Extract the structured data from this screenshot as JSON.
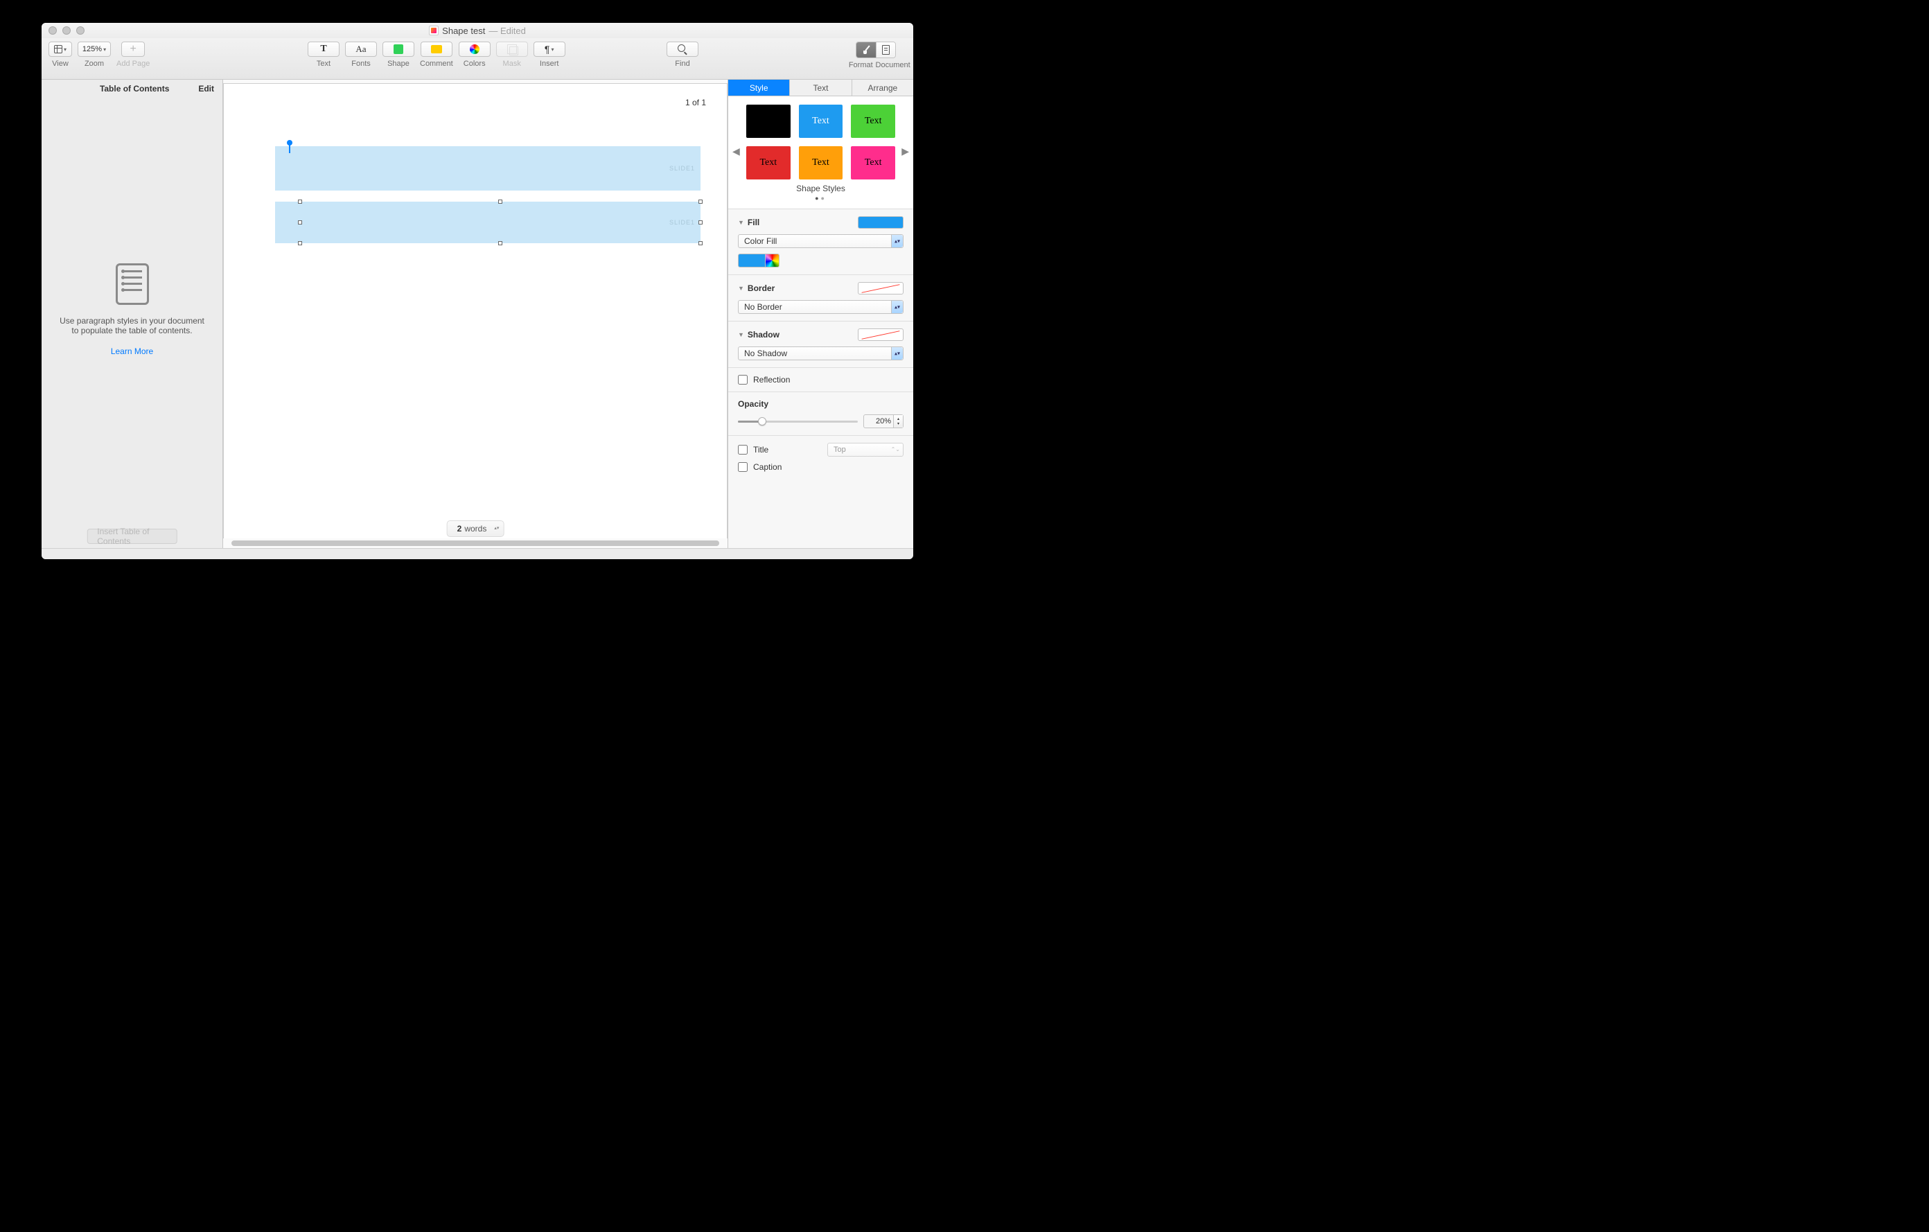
{
  "window": {
    "title": "Shape test",
    "subtitle": "— Edited"
  },
  "toolbar": {
    "left": {
      "view": "View",
      "zoom_val": "125%",
      "zoom": "Zoom",
      "addpage": "Add Page"
    },
    "center": {
      "text": "Text",
      "fonts": "Fonts",
      "shape": "Shape",
      "comment": "Comment",
      "colors": "Colors",
      "mask": "Mask",
      "insert": "Insert"
    },
    "find": "Find",
    "right": {
      "format": "Format",
      "document": "Document"
    }
  },
  "sidebar": {
    "title": "Table of Contents",
    "edit": "Edit",
    "help": "Use paragraph styles in your document to populate the table of contents.",
    "link": "Learn More",
    "insert_btn": "Insert Table of Contents"
  },
  "canvas": {
    "page_num": "1 of 1",
    "shape1_label": "SLIDE1",
    "shape2_label": "SLIDE1",
    "word_count": "2",
    "word_label": "words"
  },
  "inspector": {
    "tabs": {
      "style": "Style",
      "text": "Text",
      "arrange": "Arrange"
    },
    "styles": {
      "caption": "Shape Styles",
      "swatches": [
        {
          "bg": "#000000",
          "fg": "#ffffff",
          "label": ""
        },
        {
          "bg": "#1e9bf0",
          "fg": "#ffffff",
          "label": "Text"
        },
        {
          "bg": "#4cd137",
          "fg": "#000000",
          "label": "Text"
        },
        {
          "bg": "#e22b2b",
          "fg": "#000000",
          "label": "Text"
        },
        {
          "bg": "#ff9f0a",
          "fg": "#000000",
          "label": "Text"
        },
        {
          "bg": "#ff2d8c",
          "fg": "#000000",
          "label": "Text"
        }
      ]
    },
    "fill": {
      "header": "Fill",
      "mode": "Color Fill"
    },
    "border": {
      "header": "Border",
      "mode": "No Border"
    },
    "shadow": {
      "header": "Shadow",
      "mode": "No Shadow"
    },
    "reflection": "Reflection",
    "opacity": {
      "label": "Opacity",
      "value": "20%"
    },
    "title": {
      "label": "Title",
      "pos": "Top"
    },
    "caption": "Caption"
  }
}
